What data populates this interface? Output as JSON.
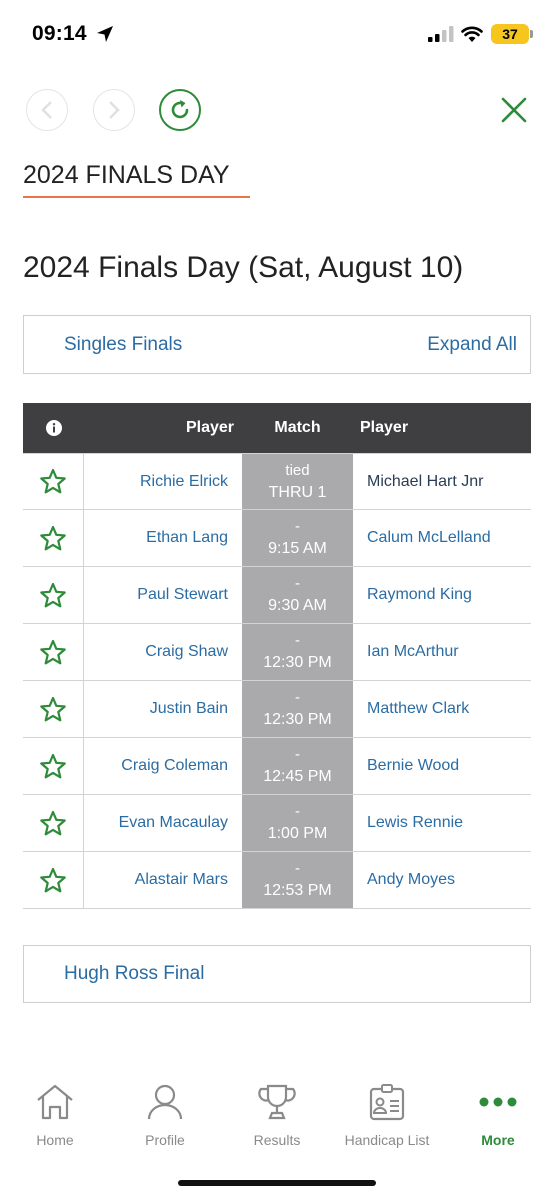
{
  "status_bar": {
    "time": "09:14",
    "battery": "37",
    "icons": [
      "location-arrow-icon",
      "signal-icon",
      "wifi-icon",
      "battery-icon"
    ]
  },
  "nav": {
    "icons": [
      "back-arrow-icon",
      "forward-arrow-icon",
      "refresh-icon",
      "close-icon"
    ],
    "accent_color": "#2e8b3a"
  },
  "section_heading": "2024 FINALS DAY",
  "page_title": "2024 Finals Day (Sat, August 10)",
  "singles": {
    "label": "Singles Finals",
    "expand_label": "Expand All"
  },
  "table": {
    "headers": {
      "info_icon": "info-icon",
      "player1": "Player",
      "match": "Match",
      "player2": "Player"
    },
    "rows": [
      {
        "player1": "Richie Elrick",
        "match_top": "tied",
        "match_bottom": "THRU 1",
        "player2": "Michael Hart Jnr"
      },
      {
        "player1": "Ethan Lang",
        "match_top": "-",
        "match_bottom": "9:15 AM",
        "player2": "Calum McLelland"
      },
      {
        "player1": "Paul Stewart",
        "match_top": "-",
        "match_bottom": "9:30 AM",
        "player2": "Raymond King"
      },
      {
        "player1": "Craig Shaw",
        "match_top": "-",
        "match_bottom": "12:30 PM",
        "player2": "Ian McArthur"
      },
      {
        "player1": "Justin Bain",
        "match_top": "-",
        "match_bottom": "12:30 PM",
        "player2": "Matthew Clark"
      },
      {
        "player1": "Craig Coleman",
        "match_top": "-",
        "match_bottom": "12:45 PM",
        "player2": "Bernie Wood"
      },
      {
        "player1": "Evan Macaulay",
        "match_top": "-",
        "match_bottom": "1:00 PM",
        "player2": "Lewis Rennie"
      },
      {
        "player1": "Alastair Mars",
        "match_top": "-",
        "match_bottom": "12:53 PM",
        "player2": "Andy Moyes"
      }
    ]
  },
  "hugh_ross": {
    "label": "Hugh Ross Final"
  },
  "tabbar": {
    "items": [
      {
        "label": "Home",
        "icon": "home-icon"
      },
      {
        "label": "Profile",
        "icon": "profile-icon"
      },
      {
        "label": "Results",
        "icon": "trophy-icon"
      },
      {
        "label": "Handicap List",
        "icon": "id-card-icon"
      },
      {
        "label": "More",
        "icon": "more-dots-icon",
        "active": true
      }
    ]
  },
  "colors": {
    "link": "#2b6ca3",
    "header_bg": "#3f3f42",
    "match_bg": "#aaaaad",
    "underline": "#e8744a",
    "star": "#2e8b3a"
  }
}
